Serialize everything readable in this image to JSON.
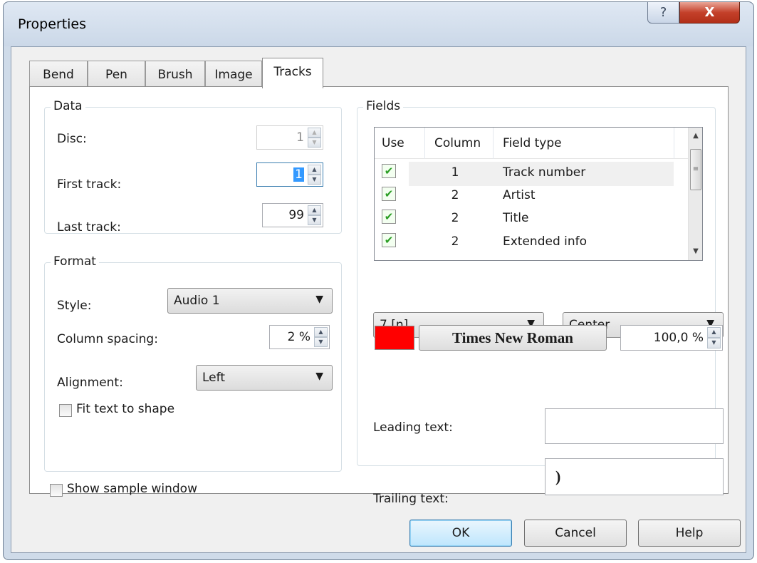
{
  "window": {
    "title": "Properties",
    "help_glyph": "?",
    "close_glyph": "X"
  },
  "tabs": [
    {
      "label": "Bend"
    },
    {
      "label": "Pen"
    },
    {
      "label": "Brush"
    },
    {
      "label": "Image"
    },
    {
      "label": "Tracks",
      "active": true
    }
  ],
  "data_group": {
    "title": "Data",
    "disc_label": "Disc:",
    "disc_value": "1",
    "first_track_label": "First track:",
    "first_track_value": "1",
    "last_track_label": "Last track:",
    "last_track_value": "99"
  },
  "format_group": {
    "title": "Format",
    "style_label": "Style:",
    "style_value": "Audio 1",
    "column_spacing_label": "Column spacing:",
    "column_spacing_value": "2 %",
    "alignment_label": "Alignment:",
    "alignment_value": "Left",
    "fit_text_label": "Fit text to shape",
    "fit_text_checked": false
  },
  "show_sample": {
    "label": "Show sample window",
    "checked": false
  },
  "fields_group": {
    "title": "Fields",
    "columns": [
      "Use",
      "Column",
      "Field type"
    ],
    "rows": [
      {
        "use": true,
        "column": "1",
        "field_type": "Track number"
      },
      {
        "use": true,
        "column": "2",
        "field_type": "Artist"
      },
      {
        "use": true,
        "column": "2",
        "field_type": "Title"
      },
      {
        "use": true,
        "column": "2",
        "field_type": "Extended info"
      }
    ],
    "size_combo_value": "7 [n]",
    "align_combo_value": "Center",
    "color": "#ff0000",
    "font_button_label": "Times New Roman",
    "scale_value": "100,0 %",
    "leading_text_label": "Leading text:",
    "leading_text_value": "",
    "trailing_text_label": "Trailing text:",
    "trailing_text_value": ")"
  },
  "buttons": {
    "ok": "OK",
    "cancel": "Cancel",
    "help": "Help"
  }
}
